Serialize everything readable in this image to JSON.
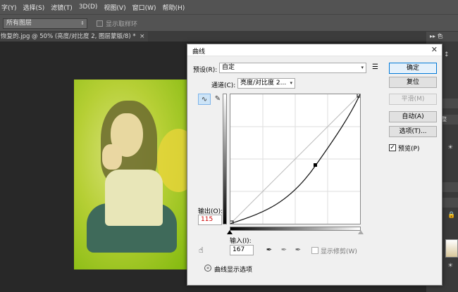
{
  "menubar": {
    "items": [
      "字(Y)",
      "选择(S)",
      "滤镜(T)",
      "3D(D)",
      "视图(V)",
      "窗口(W)",
      "帮助(H)"
    ]
  },
  "options": {
    "sample_value": "所有图层",
    "show_ring_label": "显示取样环"
  },
  "doc_tab": {
    "title": "恢复的.jpg @ 50% (亮度/对比度 2, 图层蒙版/8) *",
    "close": "×"
  },
  "right_panel": {
    "labels": [
      "调整",
      "加调整",
      "类型",
      "常"
    ]
  },
  "dialog": {
    "title": "曲线",
    "close_glyph": "✕",
    "preset_label": "预设(R):",
    "preset_value": "自定",
    "channel_label": "通道(C):",
    "channel_value": "亮度/对比度 2...",
    "output_label": "输出(O):",
    "output_value": "115",
    "input_label": "输入(I):",
    "input_value": "167",
    "show_clipping_label": "显示修剪(W)",
    "curve_options_label": "曲线显示选项",
    "buttons": {
      "ok": "确定",
      "reset": "复位",
      "smooth": "平滑(M)",
      "auto": "自动(A)",
      "options": "选项(T)...",
      "preview": "预览(P)"
    }
  }
}
